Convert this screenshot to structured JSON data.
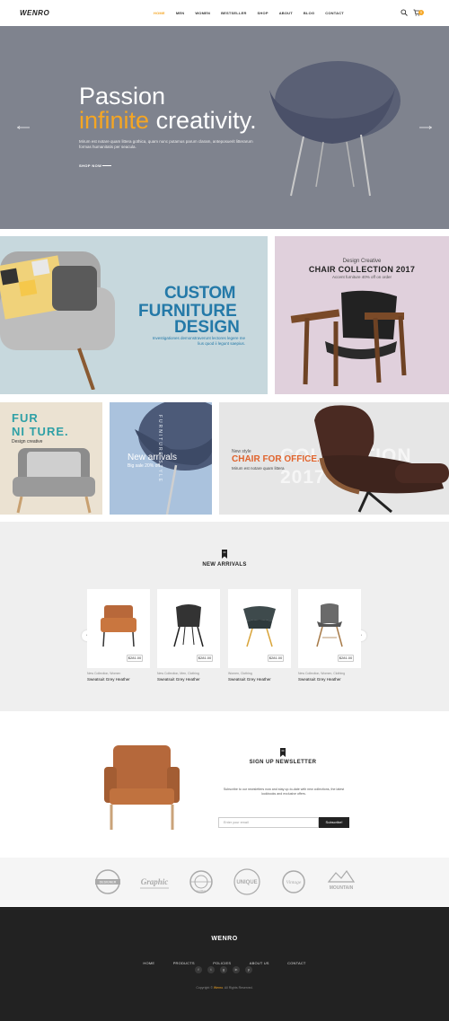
{
  "header": {
    "logo": "WENRO",
    "nav": [
      "HOME",
      "MEN",
      "WOMEN",
      "BESTSELLER",
      "SHOP",
      "ABOUT",
      "BLOG",
      "CONTACT"
    ],
    "active_nav": "HOME",
    "cart_count": "0"
  },
  "hero": {
    "line1": "Passion",
    "line2_accent": "infinite",
    "line2_rest": "creativity.",
    "description": "Mirum est notare quam littera gothica, quam nunc putamus parum claram, anteposuerit litterarum formas humanitatis per seacula.",
    "cta": "SHOP NOW"
  },
  "banners": {
    "custom": {
      "line1": "CUSTOM",
      "line2": "FURNITURE",
      "line3": "DESIGN",
      "description": "Investigationes demonstraverunt lectores legere me lius quod ii legunt saepius."
    },
    "collection": {
      "subtitle": "Design Creative",
      "title": "CHAIR COLLECTION 2017",
      "description": "Accent furniture 40% off on order"
    },
    "furniture": {
      "line1": "FUR",
      "line2": "NI TURE.",
      "subtitle": "Design creative"
    },
    "new_arrivals": {
      "title": "New arrivals",
      "subtitle": "Big sale 20% off",
      "vertical": "FURNITURE STYLE"
    },
    "office": {
      "big": "COLLECTION 2017",
      "subtitle": "New style",
      "title": "CHAIR FOR OFFICE.",
      "description": "Mirum est notare quam littera"
    }
  },
  "arrivals": {
    "title": "NEW ARRIVALS",
    "products": [
      {
        "category": "New Collection, Women",
        "name": "Sweatsuit Grey Heather",
        "price": "$281.00"
      },
      {
        "category": "New Collection, Men, Clothing",
        "name": "Sweatsuit Grey Heather",
        "price": "$281.00"
      },
      {
        "category": "Women, Clothing",
        "name": "Sweatsuit Grey Heather",
        "price": "$281.00"
      },
      {
        "category": "New Collection, Women, Clothing",
        "name": "Sweatsuit Grey Heather",
        "price": "$281.00"
      }
    ]
  },
  "newsletter": {
    "title": "SIGN UP NEWSLETTER",
    "description": "Subscribe to our newsletters now and stay up-to-date with new collections, the latest lookbooks and exclusive offers.",
    "placeholder": "Enter your email",
    "button": "Subscribe!"
  },
  "brands": [
    "DESIGNER",
    "Graphic",
    "GLOBAL",
    "UNIQUE",
    "Vintage",
    "MOUNTAIN"
  ],
  "footer": {
    "logo": "WENRO",
    "nav": [
      "HOME",
      "PRODUCTS",
      "POLICIES",
      "ABOUT US",
      "CONTACT"
    ],
    "social": [
      "f",
      "t",
      "g",
      "in",
      "p"
    ],
    "copyright_pre": "Copyright ©",
    "copyright_brand": "Wenro",
    "copyright_post": ". All Rights Reserved."
  }
}
